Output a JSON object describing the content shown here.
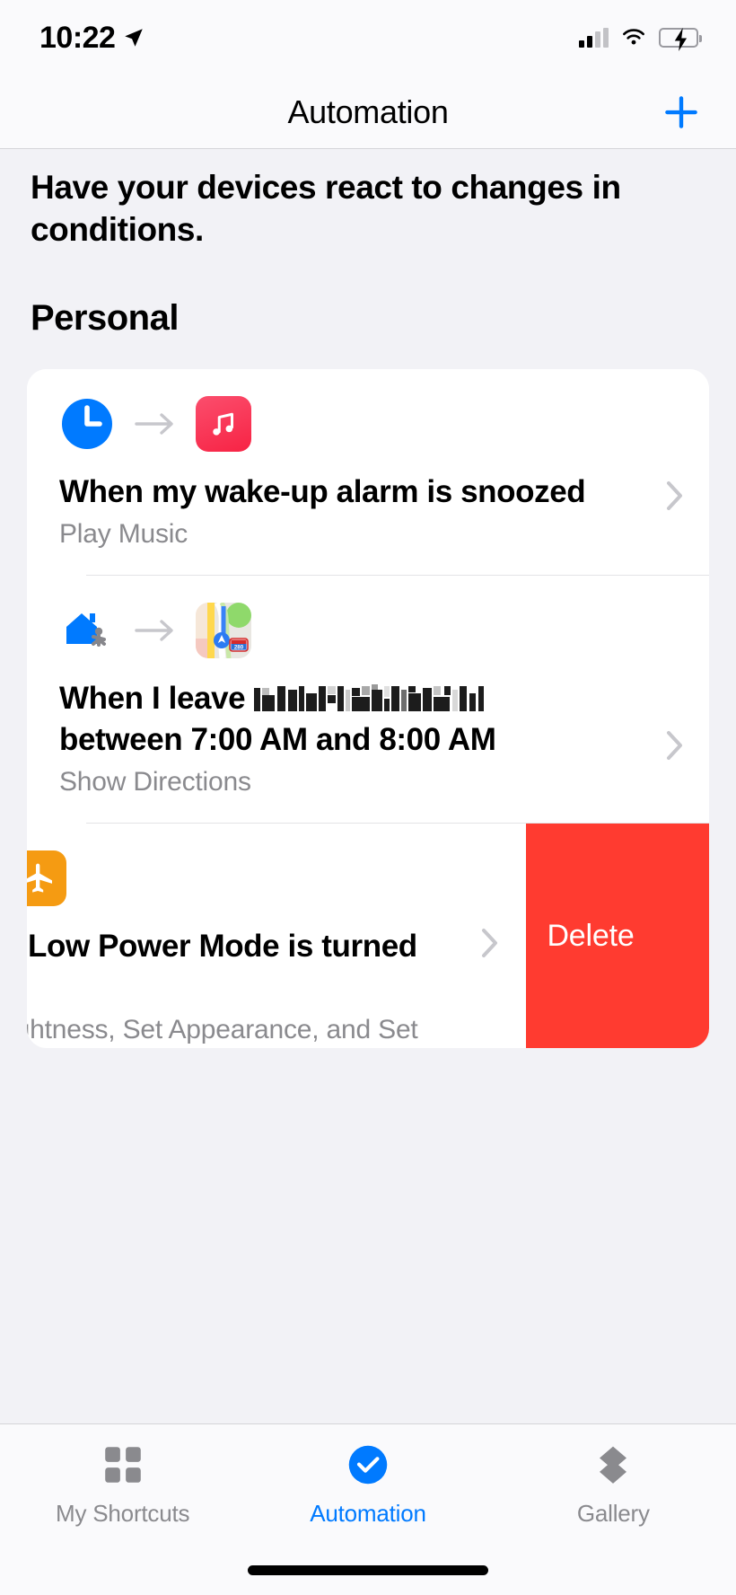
{
  "status_bar": {
    "time": "10:22",
    "location_icon": "location-arrow-icon",
    "signal_icon": "cellular-signal-icon",
    "wifi_icon": "wifi-icon",
    "battery_icon": "battery-charging-icon"
  },
  "nav": {
    "title": "Automation",
    "add_icon": "plus-icon",
    "accent_color": "#007AFF"
  },
  "main": {
    "intro": "Have your devices react to changes in conditions.",
    "section_title": "Personal",
    "automations": [
      {
        "trigger_icon": "clock-icon",
        "arrow_icon": "arrow-right-icon",
        "action_icon": "music-app-icon",
        "title": "When my wake-up alarm is snoozed",
        "subtitle": "Play Music",
        "chevron_icon": "chevron-right-icon"
      },
      {
        "trigger_icon": "leave-home-icon",
        "arrow_icon": "arrow-right-icon",
        "action_icon": "maps-app-icon",
        "title_prefix": "When I leave ",
        "title_redacted": "redacted-address",
        "title_suffix": "between 7:00 AM and 8:00 AM",
        "subtitle": "Show Directions",
        "chevron_icon": "chevron-right-icon"
      },
      {
        "trigger_icon": "brightness-icon",
        "action_icon": "airplane-mode-icon",
        "title": "When Low Power Mode is turned on",
        "subtitle": "Set Brightness, Set Appearance, and Set",
        "chevron_icon": "chevron-right-icon",
        "swiped": true,
        "delete_label": "Delete",
        "delete_color": "#FF3B30"
      }
    ]
  },
  "tabbar": {
    "tabs": [
      {
        "label": "My Shortcuts",
        "icon": "grid-squares-icon",
        "active": false
      },
      {
        "label": "Automation",
        "icon": "check-circle-icon",
        "active": true
      },
      {
        "label": "Gallery",
        "icon": "stacked-diamonds-icon",
        "active": false
      }
    ]
  }
}
